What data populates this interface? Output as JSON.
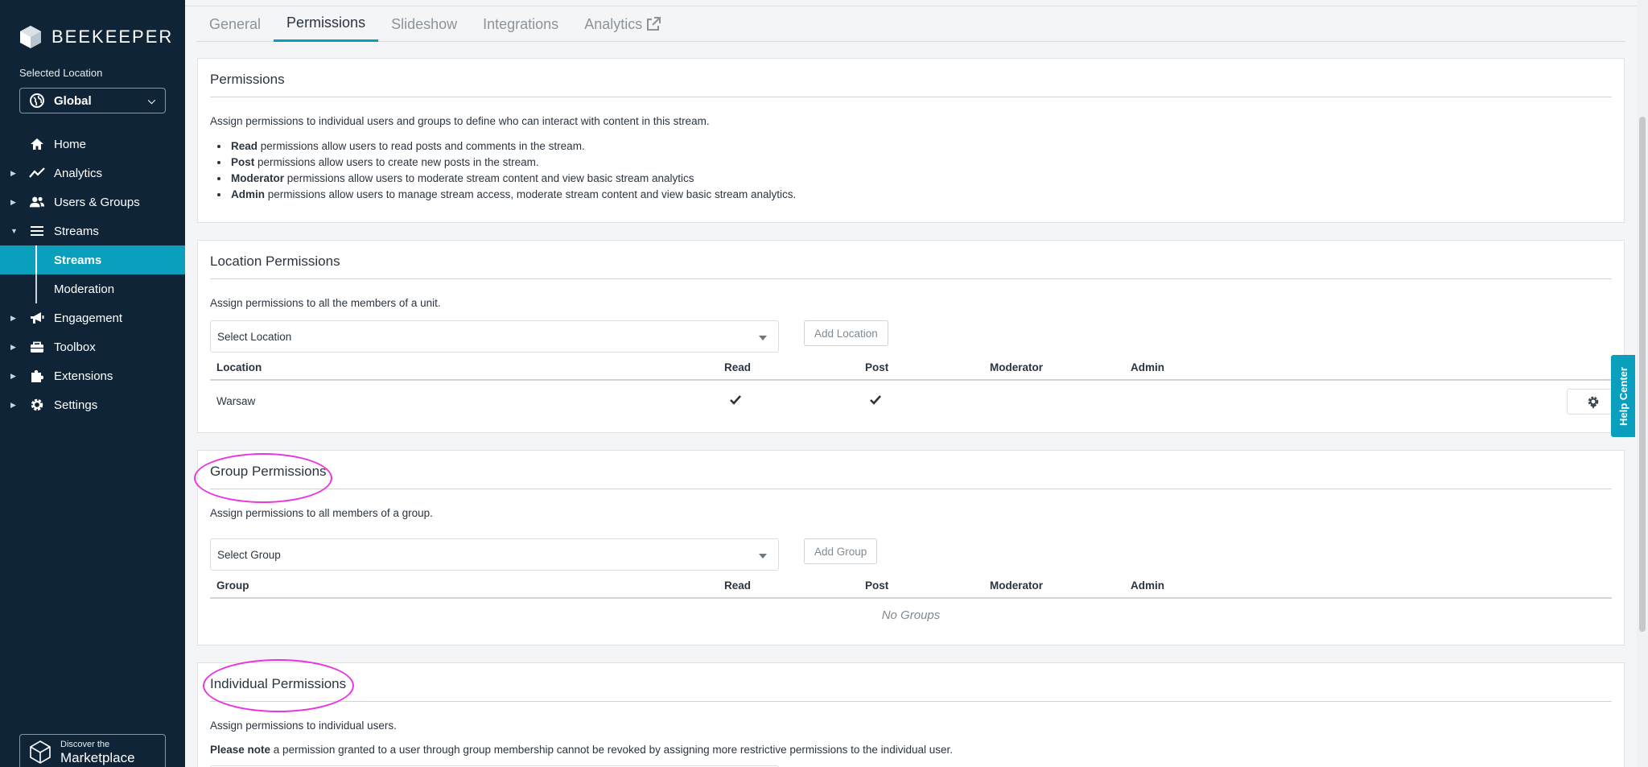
{
  "brand": {
    "name": "BEEKEEPER"
  },
  "sidebar": {
    "location_label": "Selected Location",
    "location_value": "Global",
    "items": [
      {
        "label": "Home",
        "icon": "home-icon"
      },
      {
        "label": "Analytics",
        "icon": "analytics-icon"
      },
      {
        "label": "Users & Groups",
        "icon": "users-icon"
      },
      {
        "label": "Streams",
        "icon": "streams-icon"
      },
      {
        "label": "Streams"
      },
      {
        "label": "Moderation"
      },
      {
        "label": "Engagement",
        "icon": "megaphone-icon"
      },
      {
        "label": "Toolbox",
        "icon": "toolbox-icon"
      },
      {
        "label": "Extensions",
        "icon": "puzzle-icon"
      },
      {
        "label": "Settings",
        "icon": "gear-icon"
      }
    ],
    "marketplace": {
      "line1": "Discover the",
      "line2": "Marketplace"
    }
  },
  "tabs": [
    "General",
    "Permissions",
    "Slideshow",
    "Integrations",
    "Analytics"
  ],
  "active_tab": "Permissions",
  "permissions": {
    "title": "Permissions",
    "intro": "Assign permissions to individual users and groups to define who can interact with content in this stream.",
    "bullets": [
      {
        "term": "Read",
        "text": " permissions allow users to read posts and comments in the stream."
      },
      {
        "term": "Post",
        "text": " permissions allow users to create new posts in the stream."
      },
      {
        "term": "Moderator",
        "text": " permissions allow users to moderate stream content and view basic stream analytics"
      },
      {
        "term": "Admin",
        "text": " permissions allow users to manage stream access, moderate stream content and view basic stream analytics."
      }
    ]
  },
  "location_permissions": {
    "title": "Location Permissions",
    "desc": "Assign permissions to all the members of a unit.",
    "select_placeholder": "Select Location",
    "add_label": "Add Location",
    "columns": [
      "Location",
      "Read",
      "Post",
      "Moderator",
      "Admin"
    ],
    "rows": [
      {
        "name": "Warsaw",
        "read": true,
        "post": true,
        "moderator": false,
        "admin": false
      }
    ]
  },
  "group_permissions": {
    "title": "Group Permissions",
    "desc": "Assign permissions to all members of a group.",
    "select_placeholder": "Select Group",
    "add_label": "Add Group",
    "columns": [
      "Group",
      "Read",
      "Post",
      "Moderator",
      "Admin"
    ],
    "empty": "No Groups"
  },
  "individual_permissions": {
    "title": "Individual Permissions",
    "desc": "Assign permissions to individual users.",
    "note_term": "Please note",
    "note_text": " a permission granted to a user through group membership cannot be revoked by assigning more restrictive permissions to the individual user."
  },
  "help_center": "Help Center",
  "colors": {
    "sidebar": "#0f2537",
    "accent": "#0aa0bd",
    "highlight": "#e934e0"
  }
}
